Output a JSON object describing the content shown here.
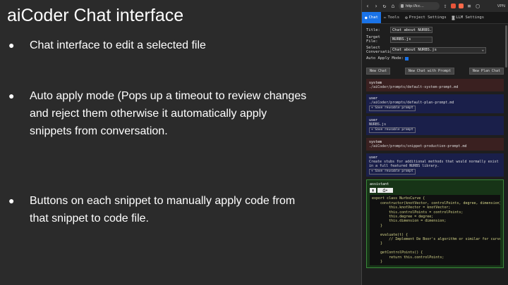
{
  "slide": {
    "title": "aiCoder Chat interface",
    "bullets": [
      "Chat interface to edit a selected file",
      "Auto apply mode (Pops up a timeout to review changes and reject them otherwise it automatically apply snippets from conversation.",
      "Buttons on each snippet to manually apply code from that snippet to code file."
    ]
  },
  "browser": {
    "url": "http://lcc…",
    "vpn": "VPN",
    "tabs": [
      "Chat",
      "Tools",
      "Project Settings",
      "LLM Settings"
    ],
    "form": {
      "title_label": "Title:",
      "title_value": "Chat about NURBS.js",
      "target_label_1": "Target",
      "target_label_2": "File:",
      "target_value": "NURBS.js",
      "select_label_1": "Select",
      "select_label_2": "Conversation:",
      "select_value": "Chat about NURBS.js",
      "auto_apply_label": "Auto Apply Mode:"
    },
    "buttons": [
      "New Chat",
      "New Chat with Prompt",
      "New Plan Chat"
    ],
    "messages": [
      {
        "role": "system",
        "text": "./aiCoder/prompts/default-system-prompt.md"
      },
      {
        "role": "user",
        "text": "./aiCoder/prompts/default-plan-prompt.md",
        "save": "+ Save reusable prompt"
      },
      {
        "role": "user",
        "text": "NURBS.js",
        "save": "+ Save reusable prompt"
      },
      {
        "role": "system",
        "text": "./aiCoder/prompts/snippet-production-prompt.md"
      },
      {
        "role": "user",
        "text": "Create stubs for additional methods that would normally exist in a full featured NURBS library.",
        "save": "+ Save reusable prompt"
      }
    ],
    "assistant": {
      "role": "assistant",
      "code": "export class NurbsCurve {\n    constructor(knotVector, controlPoints, degree, dimension) {\n        this.knotVector = knotVector;\n        this.controlPoints = controlPoints;\n        this.degree = degree;\n        this.dimension = dimension;\n    }\n\n    evaluate(t) {\n        // Implement De Boor's algorithm or similar for curve\n    }\n\n    getControlPoints() {\n        return this.controlPoints;\n    }"
    }
  },
  "colors": {
    "accent": "#1a73e8",
    "system_bg": "#3a2020",
    "user_bg": "#1a1f4a",
    "assistant_bg": "#173417"
  }
}
